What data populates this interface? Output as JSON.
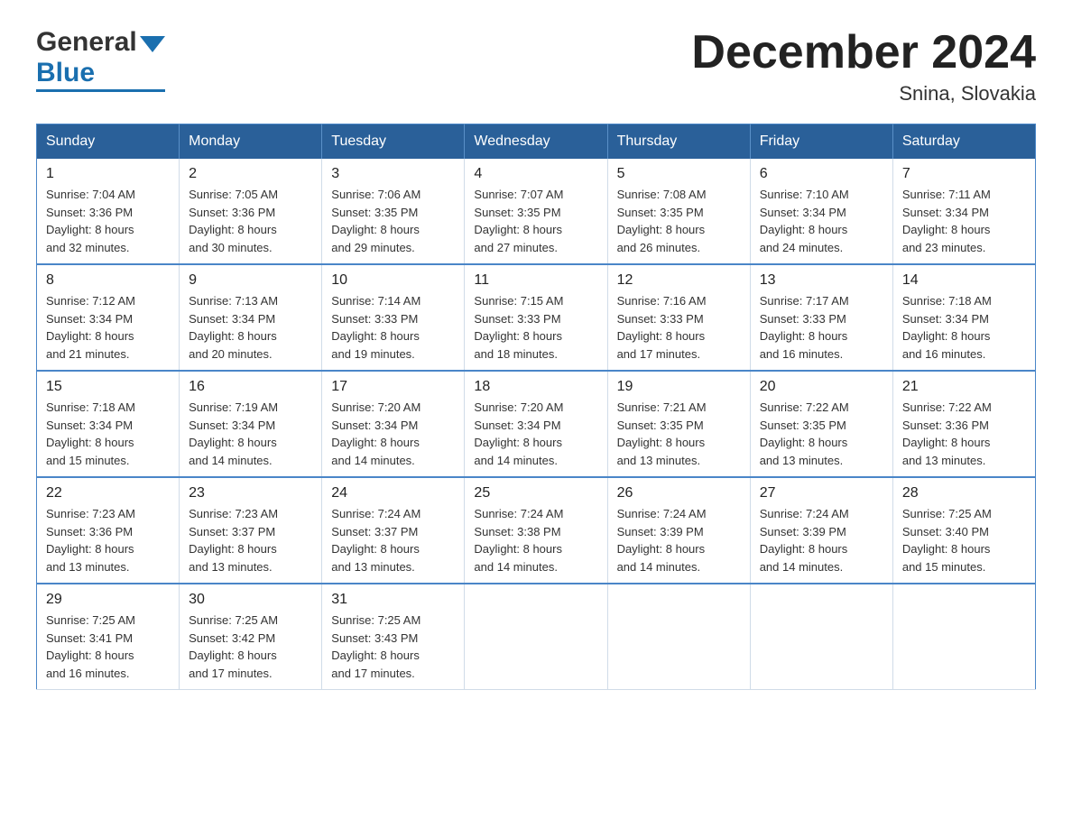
{
  "header": {
    "logo_general": "General",
    "logo_blue": "Blue",
    "month_title": "December 2024",
    "location": "Snina, Slovakia"
  },
  "weekdays": [
    "Sunday",
    "Monday",
    "Tuesday",
    "Wednesday",
    "Thursday",
    "Friday",
    "Saturday"
  ],
  "weeks": [
    [
      {
        "day": "1",
        "sunrise": "7:04 AM",
        "sunset": "3:36 PM",
        "daylight": "8 hours and 32 minutes."
      },
      {
        "day": "2",
        "sunrise": "7:05 AM",
        "sunset": "3:36 PM",
        "daylight": "8 hours and 30 minutes."
      },
      {
        "day": "3",
        "sunrise": "7:06 AM",
        "sunset": "3:35 PM",
        "daylight": "8 hours and 29 minutes."
      },
      {
        "day": "4",
        "sunrise": "7:07 AM",
        "sunset": "3:35 PM",
        "daylight": "8 hours and 27 minutes."
      },
      {
        "day": "5",
        "sunrise": "7:08 AM",
        "sunset": "3:35 PM",
        "daylight": "8 hours and 26 minutes."
      },
      {
        "day": "6",
        "sunrise": "7:10 AM",
        "sunset": "3:34 PM",
        "daylight": "8 hours and 24 minutes."
      },
      {
        "day": "7",
        "sunrise": "7:11 AM",
        "sunset": "3:34 PM",
        "daylight": "8 hours and 23 minutes."
      }
    ],
    [
      {
        "day": "8",
        "sunrise": "7:12 AM",
        "sunset": "3:34 PM",
        "daylight": "8 hours and 21 minutes."
      },
      {
        "day": "9",
        "sunrise": "7:13 AM",
        "sunset": "3:34 PM",
        "daylight": "8 hours and 20 minutes."
      },
      {
        "day": "10",
        "sunrise": "7:14 AM",
        "sunset": "3:33 PM",
        "daylight": "8 hours and 19 minutes."
      },
      {
        "day": "11",
        "sunrise": "7:15 AM",
        "sunset": "3:33 PM",
        "daylight": "8 hours and 18 minutes."
      },
      {
        "day": "12",
        "sunrise": "7:16 AM",
        "sunset": "3:33 PM",
        "daylight": "8 hours and 17 minutes."
      },
      {
        "day": "13",
        "sunrise": "7:17 AM",
        "sunset": "3:33 PM",
        "daylight": "8 hours and 16 minutes."
      },
      {
        "day": "14",
        "sunrise": "7:18 AM",
        "sunset": "3:34 PM",
        "daylight": "8 hours and 16 minutes."
      }
    ],
    [
      {
        "day": "15",
        "sunrise": "7:18 AM",
        "sunset": "3:34 PM",
        "daylight": "8 hours and 15 minutes."
      },
      {
        "day": "16",
        "sunrise": "7:19 AM",
        "sunset": "3:34 PM",
        "daylight": "8 hours and 14 minutes."
      },
      {
        "day": "17",
        "sunrise": "7:20 AM",
        "sunset": "3:34 PM",
        "daylight": "8 hours and 14 minutes."
      },
      {
        "day": "18",
        "sunrise": "7:20 AM",
        "sunset": "3:34 PM",
        "daylight": "8 hours and 14 minutes."
      },
      {
        "day": "19",
        "sunrise": "7:21 AM",
        "sunset": "3:35 PM",
        "daylight": "8 hours and 13 minutes."
      },
      {
        "day": "20",
        "sunrise": "7:22 AM",
        "sunset": "3:35 PM",
        "daylight": "8 hours and 13 minutes."
      },
      {
        "day": "21",
        "sunrise": "7:22 AM",
        "sunset": "3:36 PM",
        "daylight": "8 hours and 13 minutes."
      }
    ],
    [
      {
        "day": "22",
        "sunrise": "7:23 AM",
        "sunset": "3:36 PM",
        "daylight": "8 hours and 13 minutes."
      },
      {
        "day": "23",
        "sunrise": "7:23 AM",
        "sunset": "3:37 PM",
        "daylight": "8 hours and 13 minutes."
      },
      {
        "day": "24",
        "sunrise": "7:24 AM",
        "sunset": "3:37 PM",
        "daylight": "8 hours and 13 minutes."
      },
      {
        "day": "25",
        "sunrise": "7:24 AM",
        "sunset": "3:38 PM",
        "daylight": "8 hours and 14 minutes."
      },
      {
        "day": "26",
        "sunrise": "7:24 AM",
        "sunset": "3:39 PM",
        "daylight": "8 hours and 14 minutes."
      },
      {
        "day": "27",
        "sunrise": "7:24 AM",
        "sunset": "3:39 PM",
        "daylight": "8 hours and 14 minutes."
      },
      {
        "day": "28",
        "sunrise": "7:25 AM",
        "sunset": "3:40 PM",
        "daylight": "8 hours and 15 minutes."
      }
    ],
    [
      {
        "day": "29",
        "sunrise": "7:25 AM",
        "sunset": "3:41 PM",
        "daylight": "8 hours and 16 minutes."
      },
      {
        "day": "30",
        "sunrise": "7:25 AM",
        "sunset": "3:42 PM",
        "daylight": "8 hours and 17 minutes."
      },
      {
        "day": "31",
        "sunrise": "7:25 AM",
        "sunset": "3:43 PM",
        "daylight": "8 hours and 17 minutes."
      },
      null,
      null,
      null,
      null
    ]
  ],
  "labels": {
    "sunrise": "Sunrise:",
    "sunset": "Sunset:",
    "daylight": "Daylight:"
  }
}
